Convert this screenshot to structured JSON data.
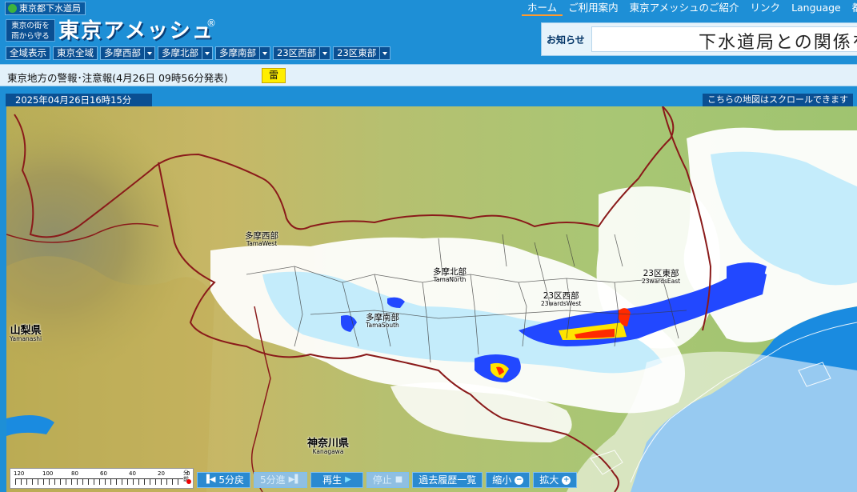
{
  "header": {
    "bureau": "東京都下水道局",
    "logo_sub_line1": "東京の街を",
    "logo_sub_line2": "雨から守る",
    "logo_main": "東京アメッシュ",
    "logo_reg": "®",
    "nav": [
      "ホーム",
      "ご利用案内",
      "東京アメッシュのご紹介",
      "リンク",
      "Language",
      "都庁"
    ],
    "notice_label": "お知らせ",
    "notice_text": "下水道局との関係を",
    "regions": [
      {
        "label": "全域表示",
        "dropdown": false
      },
      {
        "label": "東京全域",
        "dropdown": false
      },
      {
        "label": "多摩西部",
        "dropdown": true
      },
      {
        "label": "多摩北部",
        "dropdown": true
      },
      {
        "label": "多摩南部",
        "dropdown": true
      },
      {
        "label": "23区西部",
        "dropdown": true
      },
      {
        "label": "23区東部",
        "dropdown": true
      }
    ]
  },
  "warning": {
    "text": "東京地方の警報･注意報(4月26日 09時56分発表)",
    "badge": "雷",
    "badge_color": "#ffee00"
  },
  "map": {
    "timestamp": "2025年04月26日16時15分",
    "scroll_note": "こちらの地図はスクロールできます",
    "labels": {
      "tama_west_jp": "多摩西部",
      "tama_west_en": "TamaWest",
      "tama_north_jp": "多摩北部",
      "tama_north_en": "TamaNorth",
      "tama_south_jp": "多摩南部",
      "tama_south_en": "TamaSouth",
      "w23_west_jp": "23区西部",
      "w23_west_en": "23wardsWest",
      "w23_east_jp": "23区東部",
      "w23_east_en": "23wardsEast",
      "yamanashi_jp": "山梨県",
      "yamanashi_en": "Yamanashi",
      "kanagawa_jp": "神奈川県",
      "kanagawa_en": "Kanagawa"
    },
    "colors": {
      "sea": "#1a8be0",
      "rain_light": "#ffffff",
      "rain_pale": "#c4ecfb",
      "rain_blue": "#2248ff",
      "rain_heavy": "#ff2a00",
      "border": "#8a1a1a"
    }
  },
  "legend": {
    "scale": [
      "120",
      "100",
      "80",
      "60",
      "40",
      "20",
      "0"
    ],
    "unit_top": "分",
    "unit_bottom": "前"
  },
  "controls": {
    "back": "5分戻",
    "forward": "5分進",
    "play": "再生",
    "stop": "停止",
    "history": "過去履歴一覧",
    "zoom_out": "縮小",
    "zoom_in": "拡大"
  }
}
